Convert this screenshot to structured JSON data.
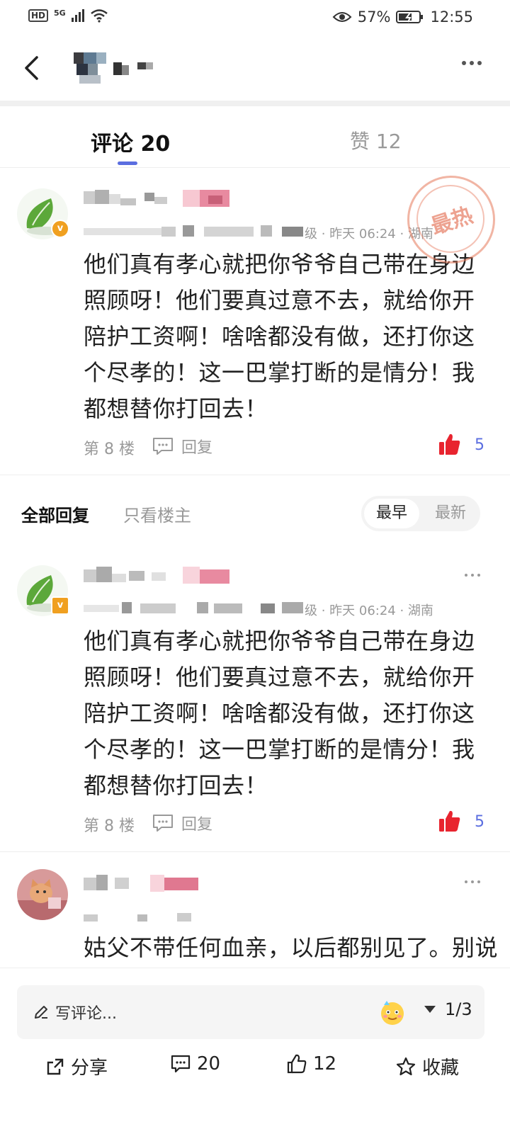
{
  "status_bar": {
    "hd": "HD",
    "network": "5G",
    "battery": "57%",
    "time": "12:55"
  },
  "tabs": {
    "comments_label": "评论 20",
    "likes_label": "赞 12"
  },
  "hot_stamp": "最热",
  "main_comment": {
    "meta": "级 · 昨天 06:24 · 湖南",
    "text": "他们真有孝心就把你爷爷自己带在身边照顾呀！他们要真过意不去，就给你开陪护工资啊！啥啥都没有做，还打你这个尽孝的！这一巴掌打断的是情分！我都想替你打回去！",
    "floor": "第 8 楼",
    "reply_label": "回复",
    "likes": "5"
  },
  "filter": {
    "all_replies": "全部回复",
    "owner_only": "只看楼主",
    "sort_earliest": "最早",
    "sort_latest": "最新"
  },
  "replies": [
    {
      "meta": "级 · 昨天 06:24 · 湖南",
      "text": "他们真有孝心就把你爷爷自己带在身边照顾呀！他们要真过意不去，就给你开陪护工资啊！啥啥都没有做，还打你这个尽孝的！这一巴掌打断的是情分！我都想替你打回去！",
      "floor": "第 8 楼",
      "reply_label": "回复",
      "likes": "5"
    },
    {
      "text": "姑父不带任何血亲，以后都别见了。别说"
    }
  ],
  "bottom": {
    "input_placeholder": "写评论...",
    "page_indicator": "1/3",
    "share_label": "分享",
    "comment_count": "20",
    "like_count": "12",
    "favorite_label": "收藏"
  },
  "colors": {
    "accent": "#5b6ee0",
    "like_red": "#e8242f",
    "stamp": "#e6785a"
  },
  "icons": [
    "back-arrow-icon",
    "more-icon",
    "comment-bubble-icon",
    "thumb-up-icon",
    "pencil-icon",
    "emoji-icon",
    "triangle-down-icon",
    "share-icon",
    "star-icon"
  ]
}
